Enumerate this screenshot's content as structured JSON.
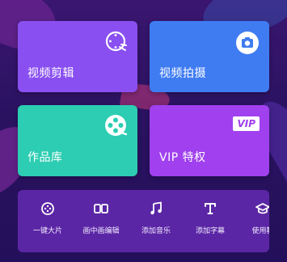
{
  "cards": {
    "video_edit": {
      "label": "视频剪辑",
      "color": "#8a4ff0",
      "icon": "video-edit-icon"
    },
    "video_shoot": {
      "label": "视频拍摄",
      "color": "#3f7cf2",
      "icon": "camera-icon"
    },
    "works": {
      "label": "作品库",
      "color": "#2ccdb2",
      "icon": "film-reel-icon"
    },
    "vip": {
      "label": "VIP 特权",
      "color": "#a040ee",
      "icon": "vip-badge-icon",
      "badge": "VIP"
    }
  },
  "tools": [
    {
      "label": "一键大片",
      "icon": "one-click-movie-icon"
    },
    {
      "label": "画中画编辑",
      "icon": "picture-in-picture-icon"
    },
    {
      "label": "添加音乐",
      "icon": "music-note-icon"
    },
    {
      "label": "添加字幕",
      "icon": "text-icon"
    },
    {
      "label": "使用教",
      "icon": "tutorial-icon"
    }
  ]
}
